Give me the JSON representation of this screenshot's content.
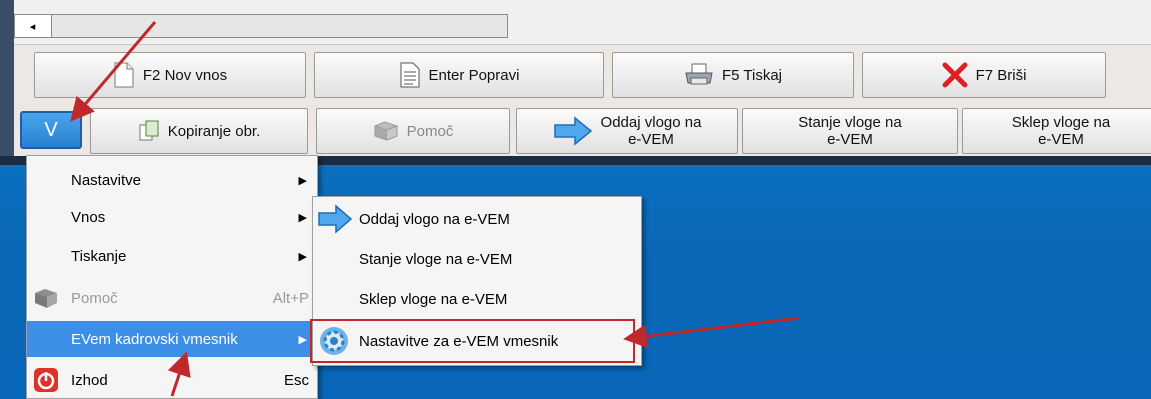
{
  "scrollbar": {
    "left_arrow": "◂"
  },
  "toolbar1": {
    "new_label": "F2 Nov vnos",
    "edit_label": "Enter Popravi",
    "print_label": "F5 Tiskaj",
    "delete_label": "F7 Briši"
  },
  "toolbar2": {
    "v_label": "V",
    "copy_label": "Kopiranje obr.",
    "help_label": "Pomoč",
    "submit_line1": "Oddaj vlogo na",
    "submit_line2": "e-VEM",
    "status_line1": "Stanje vloge na",
    "status_line2": "e-VEM",
    "decision_line1": "Sklep vloge na",
    "decision_line2": "e-VEM"
  },
  "main_menu": {
    "items": [
      {
        "label": "Nastavitve",
        "shortcut": "",
        "submenu": true
      },
      {
        "label": "Vnos",
        "shortcut": "",
        "submenu": true
      },
      {
        "label": "Tiskanje",
        "shortcut": "",
        "submenu": true
      },
      {
        "label": "Pomoč",
        "shortcut": "Alt+P",
        "submenu": false,
        "disabled": true
      },
      {
        "label": "EVem kadrovski vmesnik",
        "shortcut": "",
        "submenu": true,
        "highlighted": true
      },
      {
        "label": "Izhod",
        "shortcut": "Esc",
        "submenu": false
      }
    ],
    "submenu_arrow": "▶"
  },
  "submenu": {
    "items": [
      {
        "label": "Oddaj vlogo na e-VEM",
        "icon": "blue-arrow-icon"
      },
      {
        "label": "Stanje vloge na e-VEM",
        "icon": ""
      },
      {
        "label": "Sklep vloge na e-VEM",
        "icon": ""
      },
      {
        "label": "Nastavitve za e-VEM vmesnik",
        "icon": "gear-icon"
      }
    ]
  },
  "colors": {
    "highlight": "#3d8ee6",
    "annotation_red": "#c0282c",
    "desktop_blue": "#0a6fbf"
  }
}
